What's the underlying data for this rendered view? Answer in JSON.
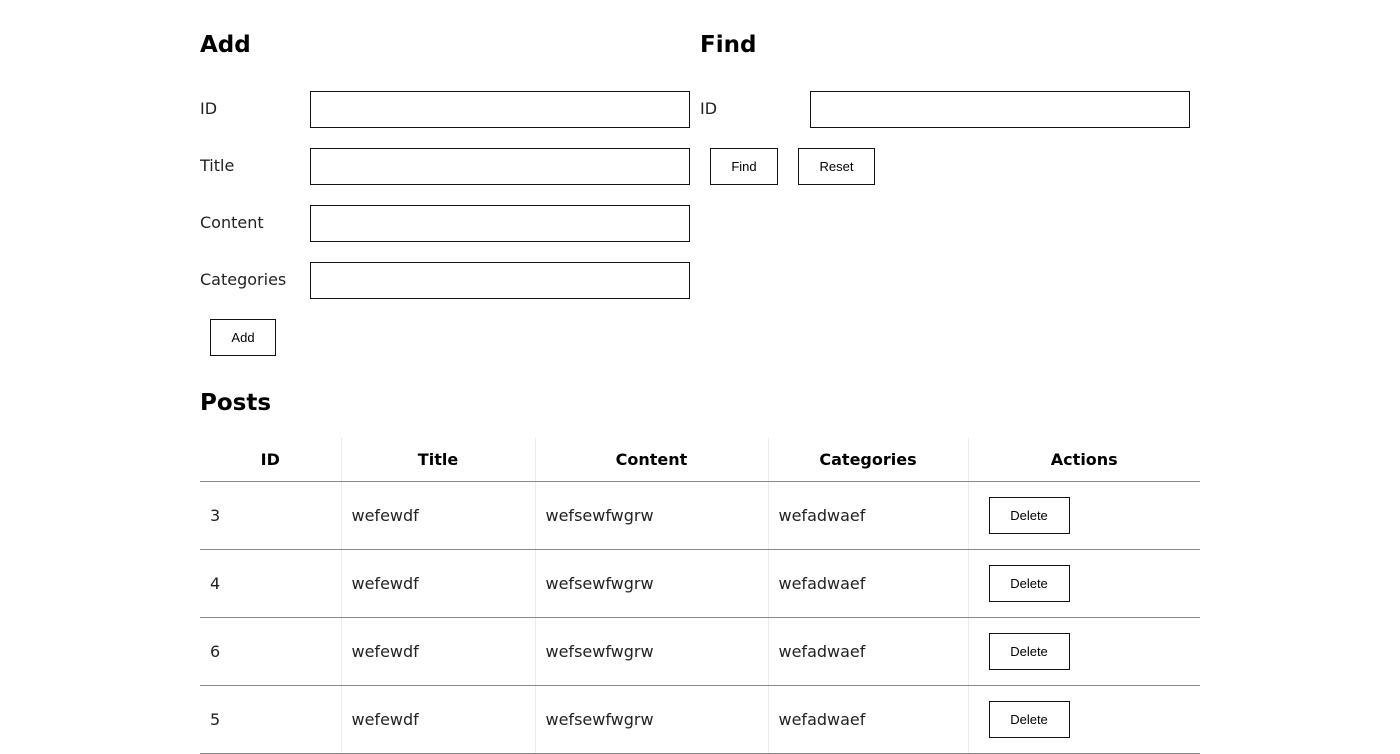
{
  "add": {
    "heading": "Add",
    "fields": [
      {
        "label": "ID",
        "value": ""
      },
      {
        "label": "Title",
        "value": ""
      },
      {
        "label": "Content",
        "value": ""
      },
      {
        "label": "Categories",
        "value": ""
      }
    ],
    "button": "Add"
  },
  "find": {
    "heading": "Find",
    "field": {
      "label": "ID",
      "value": ""
    },
    "find_button": "Find",
    "reset_button": "Reset"
  },
  "posts": {
    "heading": "Posts",
    "columns": [
      "ID",
      "Title",
      "Content",
      "Categories",
      "Actions"
    ],
    "rows": [
      {
        "id": "3",
        "title": "wefewdf",
        "content": "wefsewfwgrw",
        "categories": "wefadwaef",
        "action": "Delete"
      },
      {
        "id": "4",
        "title": "wefewdf",
        "content": "wefsewfwgrw",
        "categories": "wefadwaef",
        "action": "Delete"
      },
      {
        "id": "6",
        "title": "wefewdf",
        "content": "wefsewfwgrw",
        "categories": "wefadwaef",
        "action": "Delete"
      },
      {
        "id": "5",
        "title": "wefewdf",
        "content": "wefsewfwgrw",
        "categories": "wefadwaef",
        "action": "Delete"
      }
    ]
  }
}
